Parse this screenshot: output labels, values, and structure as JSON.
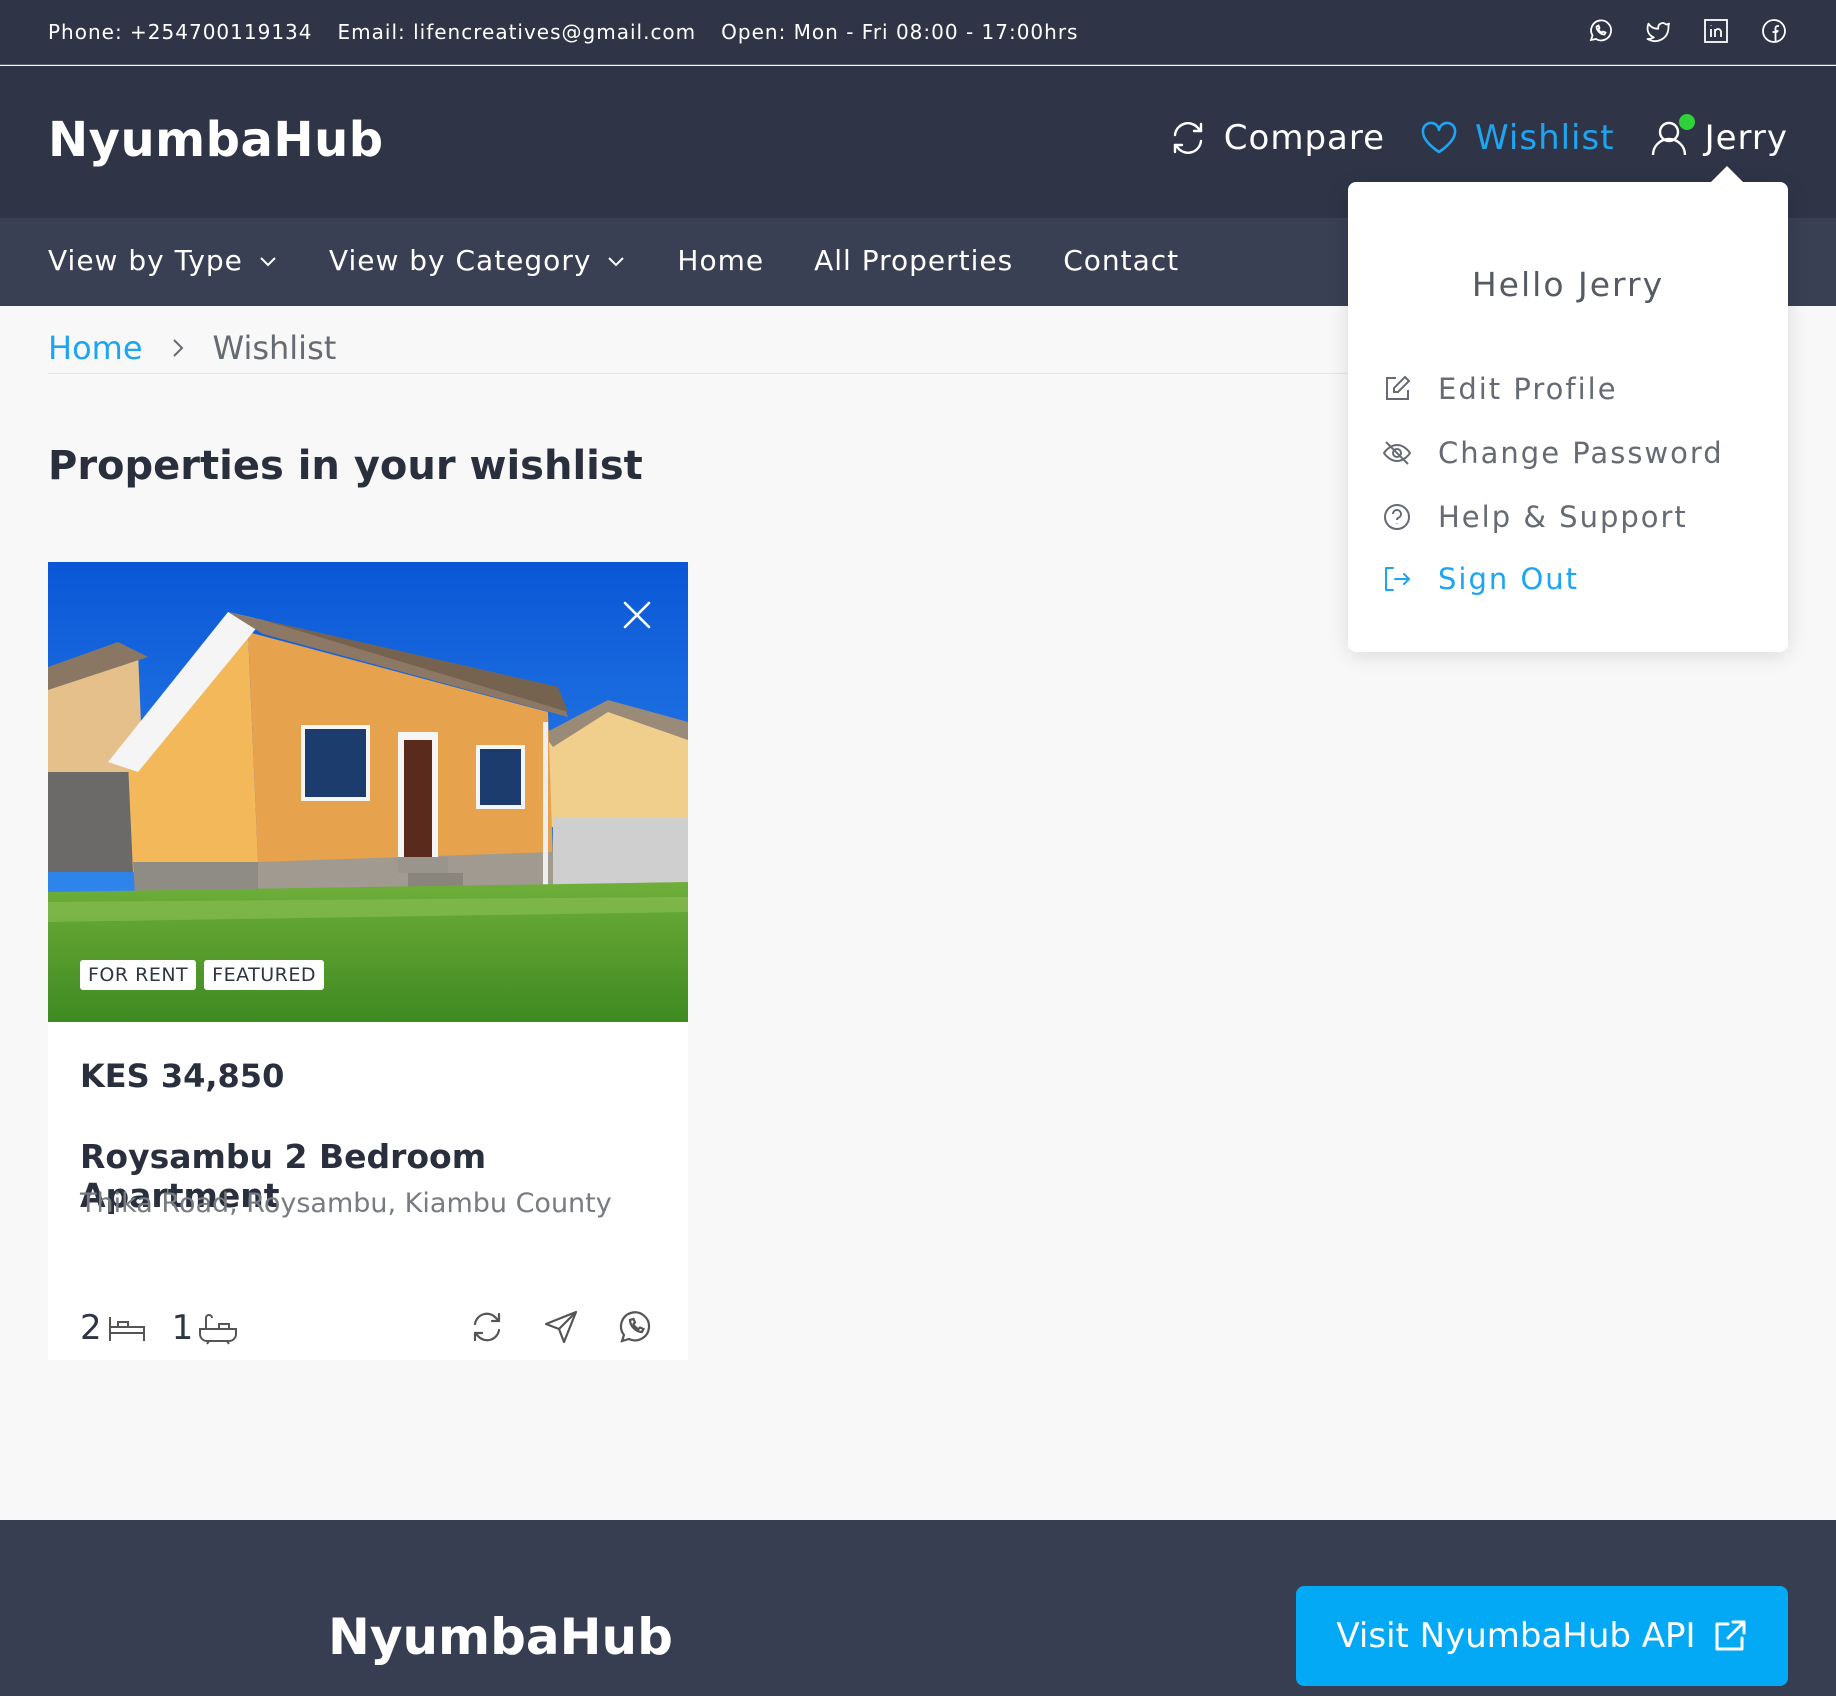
{
  "topbar": {
    "phone": "Phone: +254700119134",
    "email": "Email: lifencreatives@gmail.com",
    "hours": "Open: Mon - Fri 08:00 - 17:00hrs",
    "socials": [
      "whatsapp-icon",
      "twitter-icon",
      "linkedin-icon",
      "facebook-icon"
    ]
  },
  "header": {
    "logo": "NyumbaHub",
    "compare": "Compare",
    "wishlist": "Wishlist",
    "user": "Jerry"
  },
  "menu": {
    "view_by_type": "View by Type",
    "view_by_category": "View by Category",
    "home": "Home",
    "all_properties": "All Properties",
    "contact": "Contact"
  },
  "breadcrumb": {
    "home": "Home",
    "current": "Wishlist"
  },
  "page_title": "Properties in your wishlist",
  "property": {
    "badges": [
      "FOR RENT",
      "FEATURED"
    ],
    "price": "KES 34,850",
    "name": "Roysambu 2 Bedroom Apartment",
    "location": "Thika Road, Roysambu, Kiambu County",
    "bedrooms": "2",
    "bathrooms": "1"
  },
  "dropdown": {
    "greeting": "Hello Jerry",
    "edit_profile": "Edit Profile",
    "change_password": "Change Password",
    "help_support": "Help & Support",
    "sign_out": "Sign Out"
  },
  "footer": {
    "logo": "NyumbaHub",
    "api_button": "Visit NyumbaHub API"
  },
  "colors": {
    "accent": "#1ea5f2",
    "dark": "#2f3547",
    "online": "#2fd13a",
    "button": "#03a9f4"
  }
}
